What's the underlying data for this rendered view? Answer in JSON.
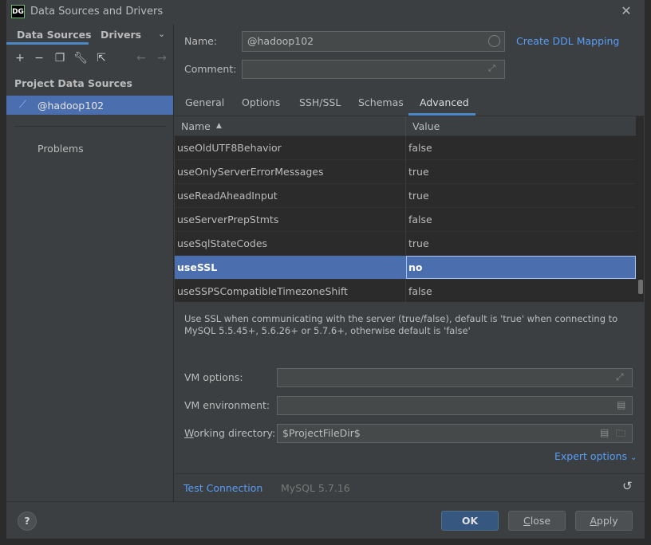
{
  "window": {
    "app_icon_text": "DG",
    "title": "Data Sources and Drivers",
    "close_icon": "close-icon"
  },
  "left": {
    "tabs": [
      "Data Sources",
      "Drivers"
    ],
    "section_title": "Project Data Sources",
    "data_source": "@hadoop102",
    "problems": "Problems"
  },
  "form": {
    "name_label": "Name:",
    "name_value": "@hadoop102",
    "ddl_link": "Create DDL Mapping",
    "comment_label": "Comment:",
    "comment_value": ""
  },
  "tabs": [
    "General",
    "Options",
    "SSH/SSL",
    "Schemas",
    "Advanced"
  ],
  "active_tab": "Advanced",
  "table": {
    "col_name": "Name",
    "col_value": "Value",
    "rows": [
      {
        "name": "useOldUTF8Behavior",
        "value": "false"
      },
      {
        "name": "useOnlyServerErrorMessages",
        "value": "true"
      },
      {
        "name": "useReadAheadInput",
        "value": "true"
      },
      {
        "name": "useServerPrepStmts",
        "value": "false"
      },
      {
        "name": "useSqlStateCodes",
        "value": "true"
      },
      {
        "name": "useSSL",
        "value": "no"
      },
      {
        "name": "useSSPSCompatibleTimezoneShift",
        "value": "false"
      }
    ],
    "selected_row": "useSSL"
  },
  "description": "Use SSL when communicating with the server (true/false), default is 'true' when connecting to MySQL 5.5.45+, 5.6.26+ or 5.7.6+, otherwise default is 'false'",
  "vm": {
    "options_label": "VM options:",
    "options_value": "",
    "env_label": "VM environment:",
    "env_value": "",
    "workdir_label_u": "W",
    "workdir_label_rest": "orking directory:",
    "workdir_value": "$ProjectFileDir$"
  },
  "expert_options": "Expert options",
  "test_connection": "Test Connection",
  "driver_version": "MySQL 5.7.16",
  "buttons": {
    "help": "?",
    "ok": "OK",
    "close_u": "C",
    "close_rest": "lose",
    "apply_u": "A",
    "apply_rest": "pply"
  },
  "colors": {
    "accent": "#4a88c7",
    "selection": "#4b6eaf",
    "link": "#589df6",
    "background": "#3c3f41"
  }
}
